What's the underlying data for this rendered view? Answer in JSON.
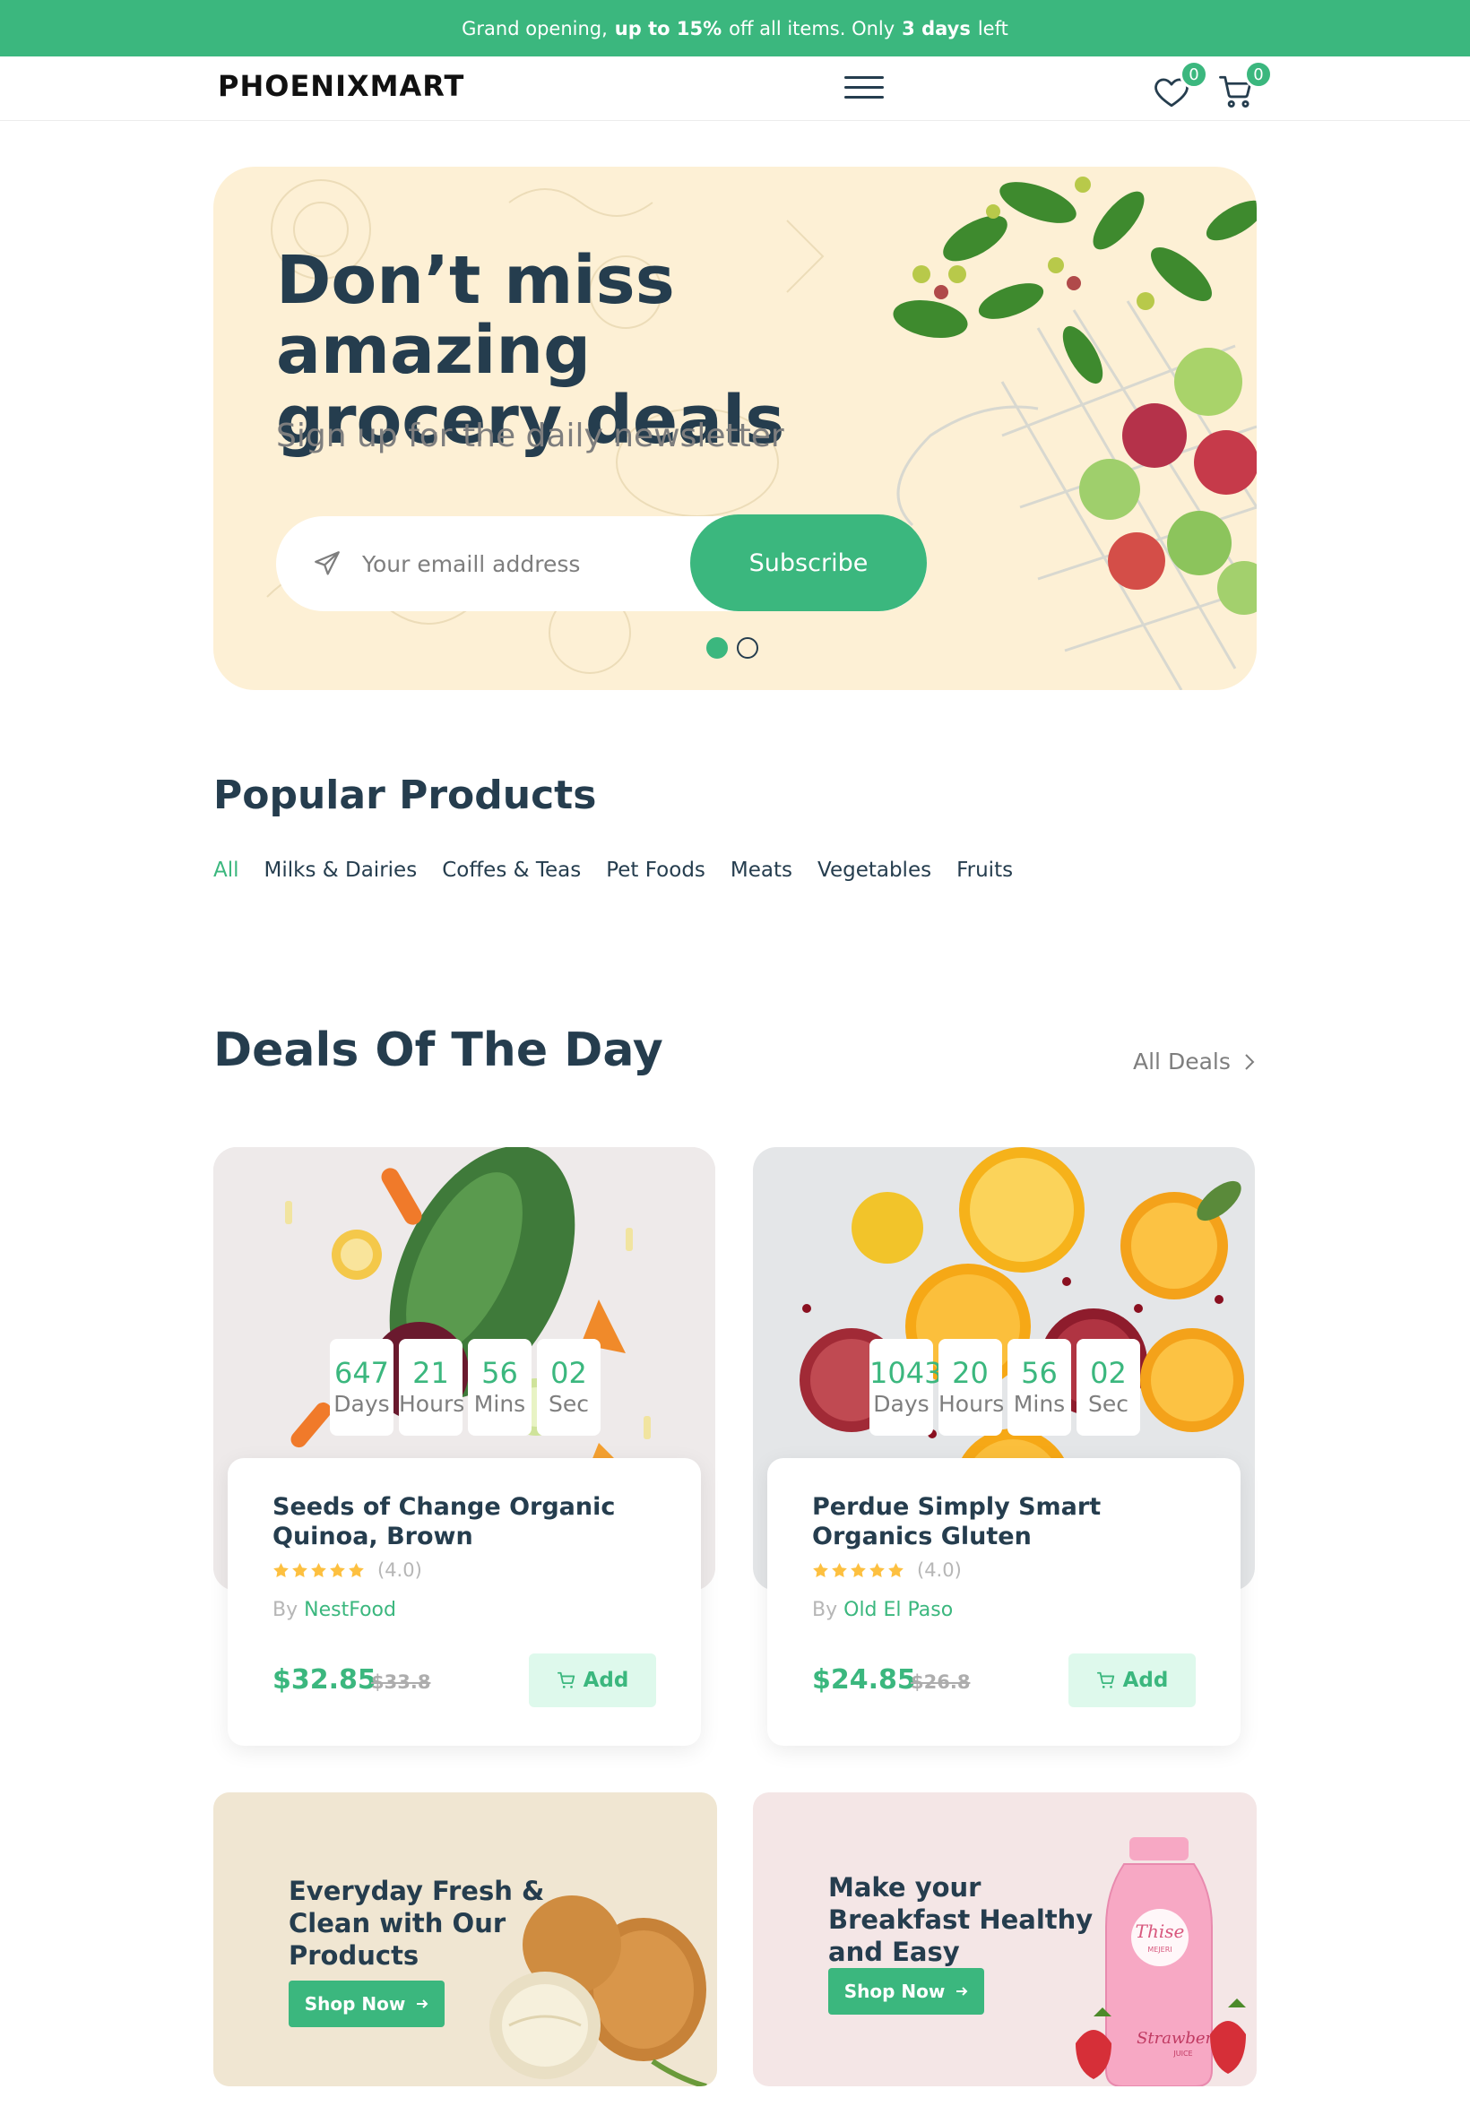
{
  "promo": {
    "prefix": "Grand opening,",
    "highlight": "up to 15%",
    "middle": "off all items. Only",
    "days": "3 days",
    "suffix": "left"
  },
  "header": {
    "logo": "PHOENIXMART",
    "wishlist_count": "0",
    "cart_count": "0"
  },
  "hero": {
    "title_line1": "Don’t miss amazing",
    "title_line2": "grocery deals",
    "subtitle": "Sign up for the daily newsletter",
    "email_placeholder": "Your emaill address",
    "subscribe_label": "Subscribe",
    "slide_count": 2,
    "active_slide": 1
  },
  "popular": {
    "title": "Popular Products",
    "tabs": [
      "All",
      "Milks & Dairies",
      "Coffes & Teas",
      "Pet Foods",
      "Meats",
      "Vegetables",
      "Fruits"
    ],
    "active_tab": 0
  },
  "deals": {
    "title": "Deals Of The Day",
    "all_label": "All Deals",
    "items": [
      {
        "timer": [
          {
            "n": "647",
            "u": "Days"
          },
          {
            "n": "21",
            "u": "Hours"
          },
          {
            "n": "56",
            "u": "Mins"
          },
          {
            "n": "02",
            "u": "Sec"
          }
        ],
        "title": "Seeds of Change Organic Quinoa, Brown",
        "rating": "(4.0)",
        "by_label": "By",
        "brand": "NestFood",
        "price": "$32.85",
        "old_price": "$33.8",
        "add_label": "Add"
      },
      {
        "timer": [
          {
            "n": "1043",
            "u": "Days"
          },
          {
            "n": "20",
            "u": "Hours"
          },
          {
            "n": "56",
            "u": "Mins"
          },
          {
            "n": "02",
            "u": "Sec"
          }
        ],
        "title": "Perdue Simply Smart Organics Gluten",
        "rating": "(4.0)",
        "by_label": "By",
        "brand": "Old El Paso",
        "price": "$24.85",
        "old_price": "$26.8",
        "add_label": "Add"
      }
    ]
  },
  "banners": [
    {
      "title": "Everyday Fresh & Clean with Our Products",
      "button": "Shop Now"
    },
    {
      "title": "Make your Breakfast Healthy and Easy",
      "button": "Shop Now",
      "bottle_brand": "Thise",
      "bottle_sub": "MEJERI",
      "bottle_flavor": "Strawberry",
      "bottle_type": "JUICE"
    }
  ],
  "colors": {
    "brand": "#3bb77e",
    "heading": "#253d4e",
    "muted": "#7e7e7e",
    "hero_bg": "#fdf0d5",
    "banner1_bg": "#f0e6d2",
    "banner2_bg": "#f4e6e6"
  }
}
